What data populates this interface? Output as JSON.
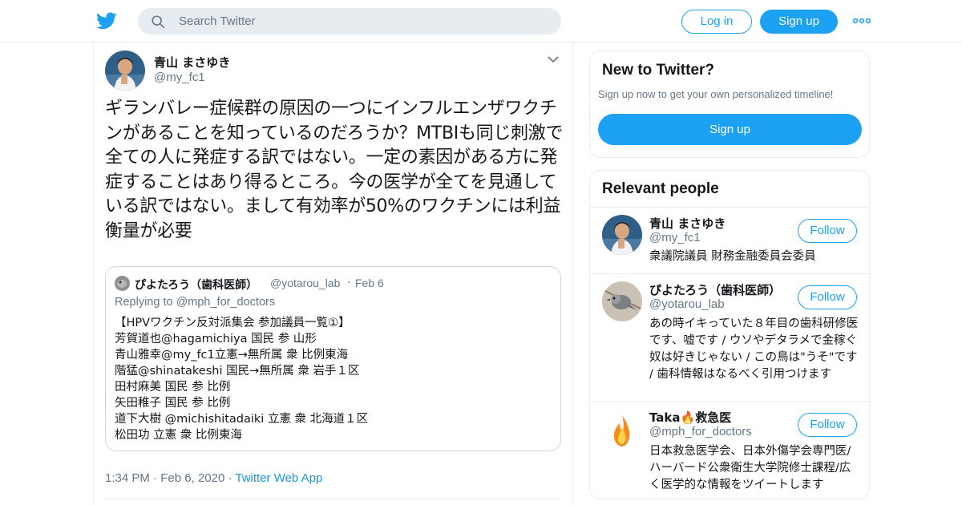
{
  "header": {
    "search_placeholder": "Search Twitter",
    "login_label": "Log in",
    "signup_label": "Sign up",
    "brand_color": "#1da1f2"
  },
  "tweet": {
    "author_name": "青山 まさゆき",
    "author_handle": "@my_fc1",
    "text": "ギランバレー症候群の原因の一つにインフルエンザワクチンがあることを知っているのだろうか？MTBIも同じ刺激で全ての人に発症する訳ではない。一定の素因がある方に発症することはあり得るところ。今の医学が全てを見通している訳ではない。まして有効率が50%のワクチンには利益衡量が必要",
    "quote": {
      "author_name": "ぴよたろう（歯科医師）",
      "author_handle": "@yotarou_lab",
      "separator": "·",
      "date": "Feb 6",
      "replying_to": "Replying to @mph_for_doctors",
      "lines": [
        "【HPVワクチン反対派集会 参加議員一覧①】",
        "芳賀道也@hagamichiya 国民 参 山形",
        "青山雅幸@my_fc1立憲→無所属 衆 比例東海",
        "階猛@shinatakeshi 国民→無所属 衆 岩手１区",
        "田村麻美 国民 参 比例",
        "矢田稚子 国民 参 比例",
        "道下大樹 @michishitadaiki 立憲 衆 北海道１区",
        "松田功 立憲 衆 比例東海"
      ]
    },
    "time": "1:34 PM",
    "separator": "·",
    "date": "Feb 6, 2020",
    "source": "Twitter Web App"
  },
  "sidebar": {
    "new_title": "New to Twitter?",
    "new_subtitle": "Sign up now to get your own personalized timeline!",
    "new_signup_label": "Sign up",
    "relevant_title": "Relevant people",
    "people": [
      {
        "name": "青山 まさゆき",
        "handle": "@my_fc1",
        "bio": "衆議院議員 財務金融委員会委員",
        "follow_label": "Follow"
      },
      {
        "name": "ぴよたろう（歯科医師）",
        "handle": "@yotarou_lab",
        "bio": "あの時イキっていた８年目の歯科研修医です、嘘です / ウソやデタラメで金稼ぐ奴は好きじゃない / この鳥は\"うそ\"です / 歯科情報はなるべく引用つけます",
        "follow_label": "Follow"
      },
      {
        "name": "Taka🔥救急医",
        "handle": "@mph_for_doctors",
        "bio": "日本救急医学会、日本外傷学会専門医/ハーバード公衆衛生大学院修士課程/広く医学的な情報をツイートします",
        "follow_label": "Follow"
      }
    ]
  }
}
